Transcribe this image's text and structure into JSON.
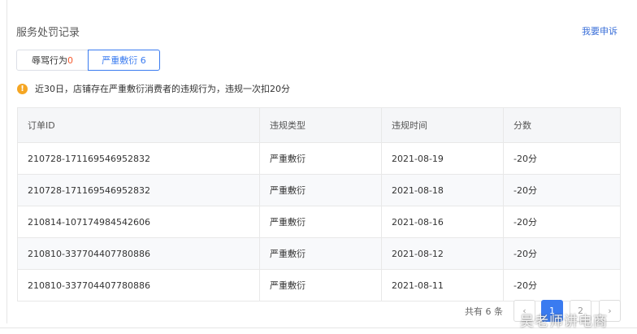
{
  "header": {
    "title": "服务处罚记录",
    "appeal_link": "我要申诉"
  },
  "tabs": [
    {
      "label": "辱骂行为",
      "count": "0"
    },
    {
      "label": "严重敷衍",
      "count": "6"
    }
  ],
  "notice": {
    "icon": "warning-icon",
    "text": "近30日，店铺存在严重敷衍消费者的违规行为，违规一次扣20分"
  },
  "table": {
    "columns": [
      "订单ID",
      "违规类型",
      "违规时间",
      "分数"
    ],
    "rows": [
      [
        "210728-171169546952832",
        "严重敷衍",
        "2021-08-19",
        "-20分"
      ],
      [
        "210728-171169546952832",
        "严重敷衍",
        "2021-08-18",
        "-20分"
      ],
      [
        "210814-107174984542606",
        "严重敷衍",
        "2021-08-16",
        "-20分"
      ],
      [
        "210810-337704407780886",
        "严重敷衍",
        "2021-08-12",
        "-20分"
      ],
      [
        "210810-337704407780886",
        "严重敷衍",
        "2021-08-11",
        "-20分"
      ]
    ]
  },
  "pagination": {
    "total": "共有 6 条",
    "prev": "‹",
    "pages": [
      "1",
      "2"
    ],
    "next": "›",
    "current": "1"
  },
  "watermark": "吴老师讲电商",
  "colors": {
    "accent": "#3a7bf0",
    "warning": "#f5a623",
    "count_red": "#f5592e"
  }
}
